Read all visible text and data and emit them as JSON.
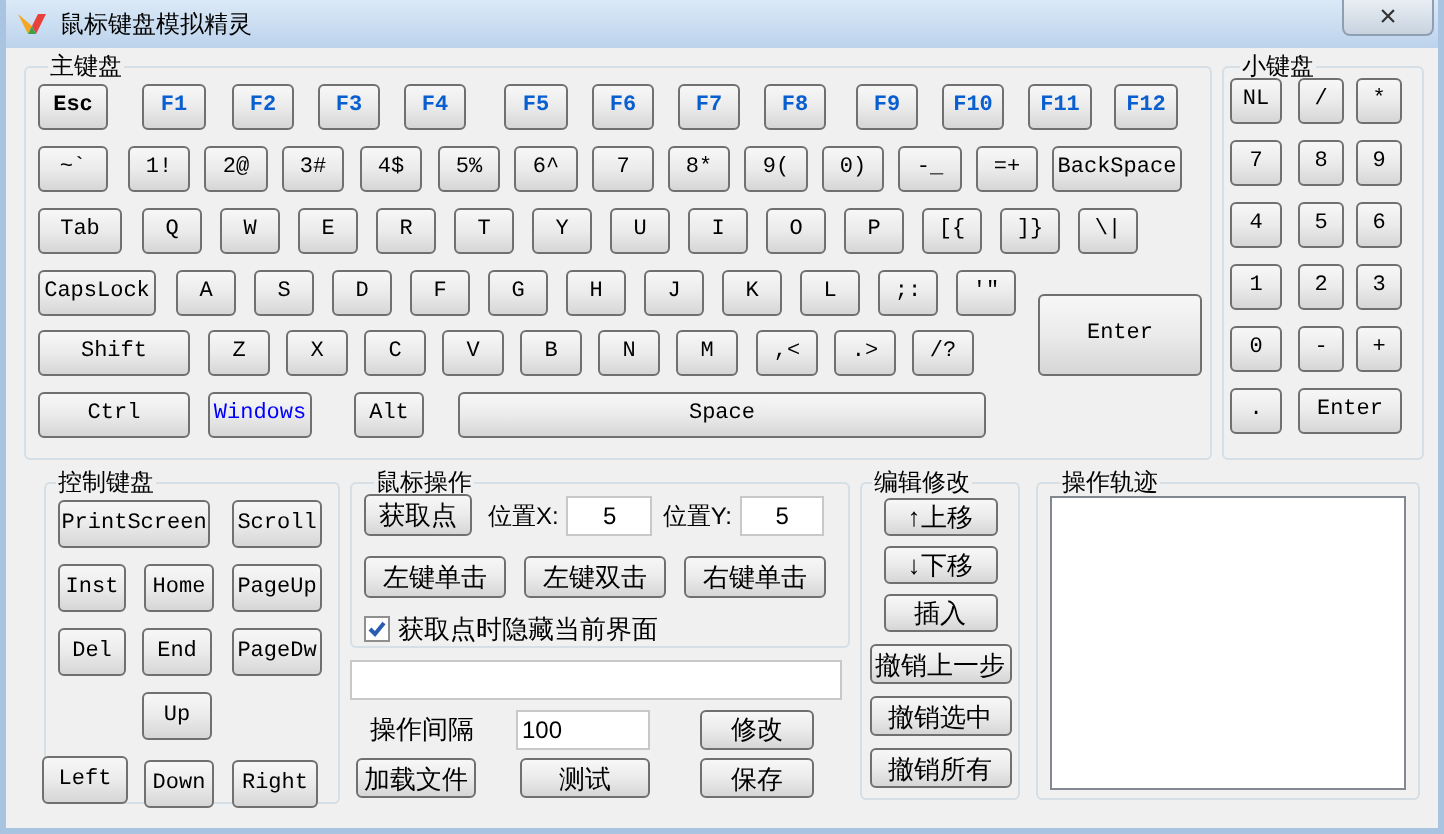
{
  "window": {
    "title": "鼠标键盘模拟精灵",
    "close": "×"
  },
  "main_keyboard": {
    "title": "主键盘",
    "rows": [
      [
        {
          "label": "Esc",
          "kind": "bold"
        },
        {
          "label": "F1",
          "kind": "fn"
        },
        {
          "label": "F2",
          "kind": "fn"
        },
        {
          "label": "F3",
          "kind": "fn"
        },
        {
          "label": "F4",
          "kind": "fn"
        },
        {
          "label": "F5",
          "kind": "fn"
        },
        {
          "label": "F6",
          "kind": "fn"
        },
        {
          "label": "F7",
          "kind": "fn"
        },
        {
          "label": "F8",
          "kind": "fn"
        },
        {
          "label": "F9",
          "kind": "fn"
        },
        {
          "label": "F10",
          "kind": "fn"
        },
        {
          "label": "F11",
          "kind": "fn"
        },
        {
          "label": "F12",
          "kind": "fn"
        }
      ],
      [
        {
          "label": "~`",
          "kind": "plain"
        },
        {
          "label": "1!",
          "kind": "plain"
        },
        {
          "label": "2@",
          "kind": "plain"
        },
        {
          "label": "3#",
          "kind": "plain"
        },
        {
          "label": "4$",
          "kind": "plain"
        },
        {
          "label": "5%",
          "kind": "plain"
        },
        {
          "label": "6^",
          "kind": "plain"
        },
        {
          "label": "7",
          "kind": "plain"
        },
        {
          "label": "8*",
          "kind": "plain"
        },
        {
          "label": "9(",
          "kind": "plain"
        },
        {
          "label": "0)",
          "kind": "plain"
        },
        {
          "label": "-_",
          "kind": "plain"
        },
        {
          "label": "=+",
          "kind": "plain"
        },
        {
          "label": "BackSpace",
          "kind": "plain"
        }
      ],
      [
        {
          "label": "Tab",
          "kind": "plain"
        },
        {
          "label": "Q",
          "kind": "plain"
        },
        {
          "label": "W",
          "kind": "plain"
        },
        {
          "label": "E",
          "kind": "plain"
        },
        {
          "label": "R",
          "kind": "plain"
        },
        {
          "label": "T",
          "kind": "plain"
        },
        {
          "label": "Y",
          "kind": "plain"
        },
        {
          "label": "U",
          "kind": "plain"
        },
        {
          "label": "I",
          "kind": "plain"
        },
        {
          "label": "O",
          "kind": "plain"
        },
        {
          "label": "P",
          "kind": "plain"
        },
        {
          "label": "[{",
          "kind": "plain"
        },
        {
          "label": "]}",
          "kind": "plain"
        },
        {
          "label": "\\|",
          "kind": "plain"
        }
      ],
      [
        {
          "label": "CapsLock",
          "kind": "plain"
        },
        {
          "label": "A",
          "kind": "plain"
        },
        {
          "label": "S",
          "kind": "plain"
        },
        {
          "label": "D",
          "kind": "plain"
        },
        {
          "label": "F",
          "kind": "plain"
        },
        {
          "label": "G",
          "kind": "plain"
        },
        {
          "label": "H",
          "kind": "plain"
        },
        {
          "label": "J",
          "kind": "plain"
        },
        {
          "label": "K",
          "kind": "plain"
        },
        {
          "label": "L",
          "kind": "plain"
        },
        {
          "label": ";:",
          "kind": "plain"
        },
        {
          "label": "'\"",
          "kind": "plain"
        }
      ],
      [
        {
          "label": "Shift",
          "kind": "plain"
        },
        {
          "label": "Z",
          "kind": "plain"
        },
        {
          "label": "X",
          "kind": "plain"
        },
        {
          "label": "C",
          "kind": "plain"
        },
        {
          "label": "V",
          "kind": "plain"
        },
        {
          "label": "B",
          "kind": "plain"
        },
        {
          "label": "N",
          "kind": "plain"
        },
        {
          "label": "M",
          "kind": "plain"
        },
        {
          "label": ",<",
          "kind": "plain"
        },
        {
          "label": ".>",
          "kind": "plain"
        },
        {
          "label": "/?",
          "kind": "plain"
        }
      ],
      [
        {
          "label": "Ctrl",
          "kind": "plain"
        },
        {
          "label": "Windows",
          "kind": "win"
        },
        {
          "label": "Alt",
          "kind": "plain"
        },
        {
          "label": "Space",
          "kind": "plain"
        }
      ]
    ],
    "enter": {
      "label": "Enter"
    }
  },
  "numpad": {
    "title": "小键盘",
    "rows": [
      [
        {
          "label": "NL"
        },
        {
          "label": "/"
        },
        {
          "label": "*"
        }
      ],
      [
        {
          "label": "7"
        },
        {
          "label": "8"
        },
        {
          "label": "9"
        }
      ],
      [
        {
          "label": "4"
        },
        {
          "label": "5"
        },
        {
          "label": "6"
        }
      ],
      [
        {
          "label": "1"
        },
        {
          "label": "2"
        },
        {
          "label": "3"
        }
      ],
      [
        {
          "label": "0"
        },
        {
          "label": "-"
        },
        {
          "label": "+"
        }
      ],
      [
        {
          "label": "."
        },
        {
          "label": "Enter"
        }
      ]
    ]
  },
  "control_keyboard": {
    "title": "控制键盘",
    "rows": [
      [
        "PrintScreen",
        "",
        "Scroll"
      ],
      [
        "Inst",
        "Home",
        "PageUp"
      ],
      [
        "Del",
        "End",
        "PageDw"
      ],
      [
        "",
        "Up"
      ],
      [
        "Left",
        "Down",
        "Right"
      ]
    ]
  },
  "mouse_ops": {
    "title": "鼠标操作",
    "get_point": "获取点",
    "x_label": "位置X:",
    "x_value": "5",
    "y_label": "位置Y:",
    "y_value": "5",
    "clicks": [
      "左键单击",
      "左键双击",
      "右键单击"
    ],
    "hide_option": {
      "label": "获取点时隐藏当前界面",
      "checked": true
    }
  },
  "interval": {
    "label": "操作间隔",
    "value": "100",
    "modify": "修改",
    "load": "加载文件",
    "test": "测试",
    "save": "保存"
  },
  "edit": {
    "title": "编辑修改",
    "buttons": [
      "↑上移",
      "↓下移",
      "插入",
      "撤销上一步",
      "撤销选中",
      "撤销所有"
    ]
  },
  "trace": {
    "title": "操作轨迹"
  }
}
